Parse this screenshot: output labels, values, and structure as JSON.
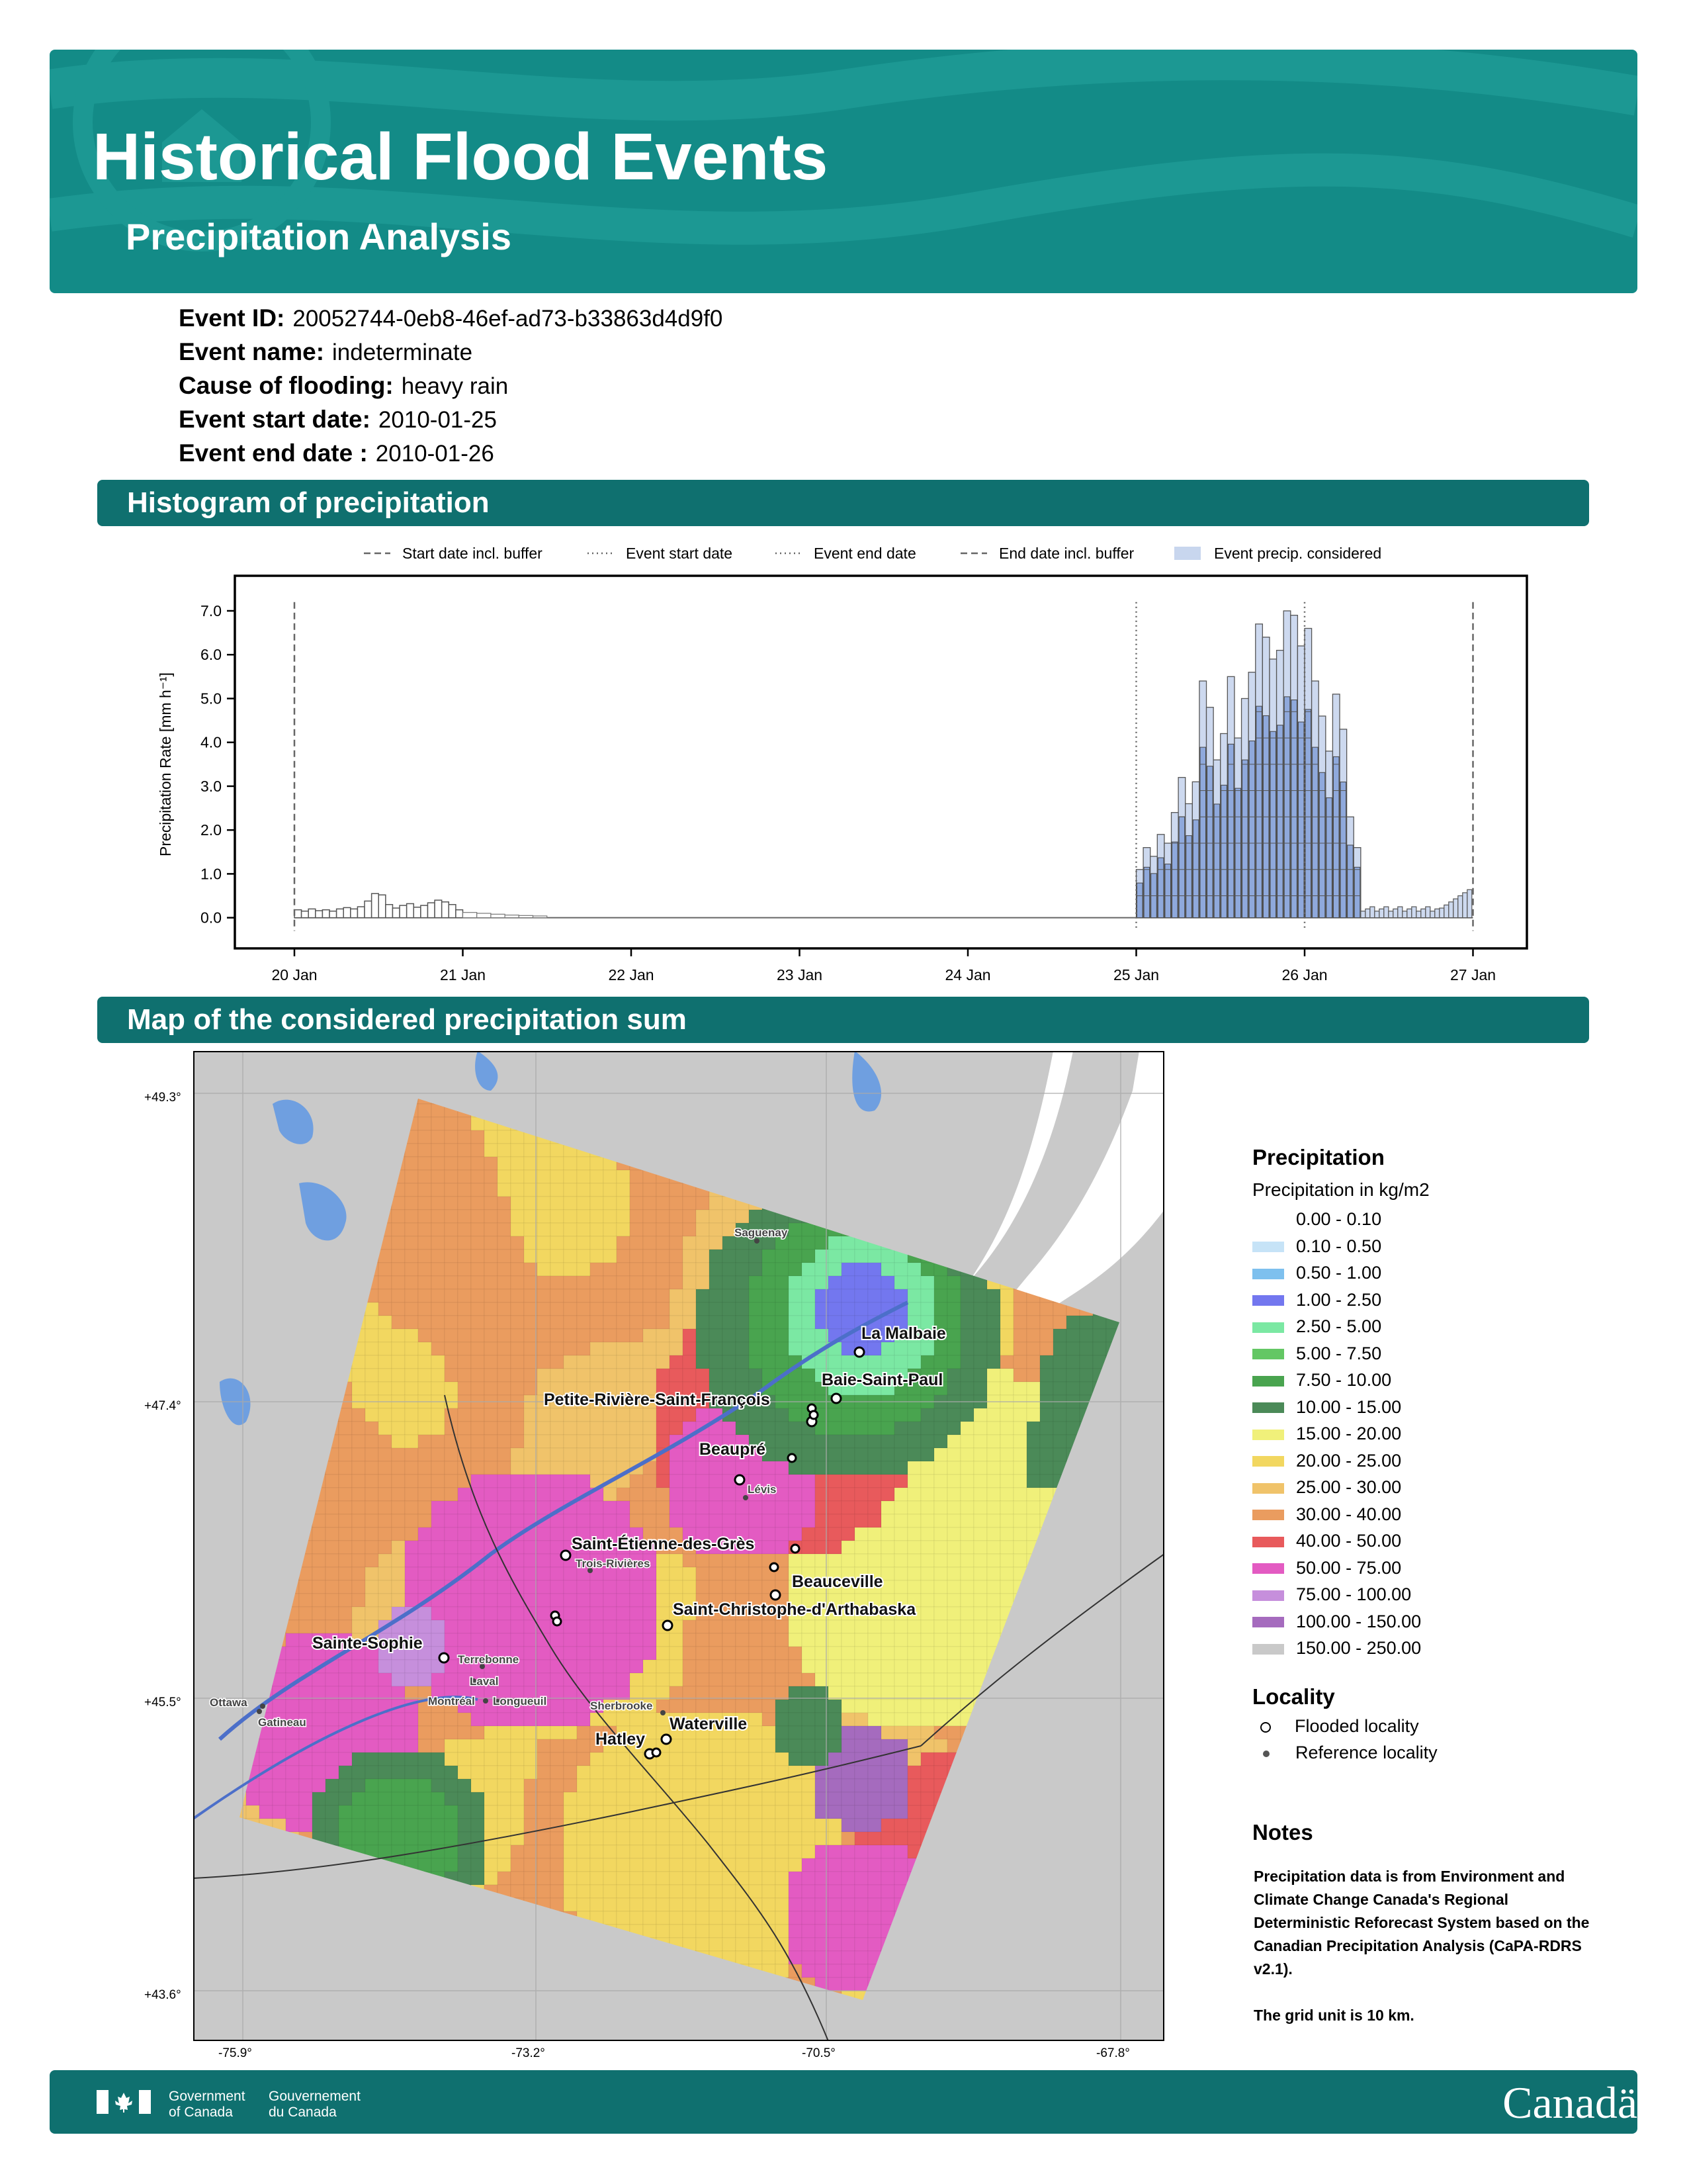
{
  "header": {
    "title": "Historical Flood Events",
    "subtitle": "Precipitation Analysis"
  },
  "event": {
    "id_label": "Event ID:",
    "id_value": "20052744-0eb8-46ef-ad73-b33863d4d9f0",
    "name_label": "Event name:",
    "name_value": "indeterminate",
    "cause_label": "Cause of flooding:",
    "cause_value": "heavy rain",
    "start_label": "Event start date:",
    "start_value": "2010-01-25",
    "end_label": "Event end date :",
    "end_value": "2010-01-26"
  },
  "sections": {
    "histogram": "Histogram of precipitation",
    "map": "Map of the considered precipitation sum"
  },
  "chart_data": {
    "type": "bar",
    "ylabel": "Precipitation Rate [mm h⁻¹]",
    "ylim": [
      -0.7,
      7.8
    ],
    "yticks": [
      "0.0",
      "1.0",
      "2.0",
      "3.0",
      "4.0",
      "5.0",
      "6.0",
      "7.0"
    ],
    "xticks": [
      "20 Jan",
      "21 Jan",
      "22 Jan",
      "23 Jan",
      "24 Jan",
      "25 Jan",
      "26 Jan",
      "27 Jan"
    ],
    "legend": [
      "Start date incl. buffer",
      "Event start date",
      "Event end date",
      "End date incl. buffer",
      "Event precip. considered"
    ],
    "event_envelope_hourly_from_25Jan": [
      1.1,
      1.6,
      1.4,
      1.9,
      1.7,
      2.4,
      3.2,
      2.6,
      3.1,
      5.4,
      4.8,
      3.6,
      4.2,
      5.5,
      4.1,
      5.0,
      5.6,
      6.7,
      6.4,
      5.9,
      6.1,
      7.0,
      6.9,
      6.2,
      6.6,
      5.4,
      4.6,
      3.8,
      5.1,
      4.3,
      2.3,
      1.6
    ],
    "pre_event_envelope_20Jan": [
      0.18,
      0.15,
      0.2,
      0.16,
      0.18,
      0.15,
      0.2,
      0.23,
      0.2,
      0.25,
      0.38,
      0.55,
      0.52,
      0.3,
      0.22,
      0.28,
      0.32,
      0.24,
      0.28,
      0.34,
      0.4,
      0.36,
      0.3,
      0.18
    ]
  },
  "map": {
    "lat_labels": [
      "+49.3°",
      "+47.4°",
      "+45.5°",
      "+43.6°"
    ],
    "lon_labels": [
      "-75.9°",
      "-73.2°",
      "-70.5°",
      "-67.8°"
    ],
    "flooded_localities": [
      "La Malbaie",
      "Baie-Saint-Paul",
      "Petite-Rivière-Saint-François",
      "Beaupré",
      "Saint-Étienne-des-Grès",
      "Beauceville",
      "Saint-Christophe-d'Arthabaska",
      "Sainte-Sophie",
      "Waterville",
      "Hatley"
    ],
    "reference_localities": [
      "Saguenay",
      "Lévis",
      "Trois-Rivières",
      "Terrebonne",
      "Laval",
      "Montréal",
      "Longueuil",
      "Sherbrooke",
      "Ottawa",
      "Gatineau"
    ]
  },
  "legend": {
    "precip_title": "Precipitation",
    "precip_sub": "Precipitation in kg/m2",
    "classes": [
      {
        "label": "0.00 - 0.10",
        "color": "#ffffff"
      },
      {
        "label": "0.10 - 0.50",
        "color": "#c6e3f7"
      },
      {
        "label": "0.50 - 1.00",
        "color": "#7ec0ee"
      },
      {
        "label": "1.00 - 2.50",
        "color": "#7377ef"
      },
      {
        "label": "2.50 - 5.00",
        "color": "#7be8a3"
      },
      {
        "label": "5.00 - 7.50",
        "color": "#63c764"
      },
      {
        "label": "7.50 - 10.00",
        "color": "#49a44f"
      },
      {
        "label": "10.00 - 15.00",
        "color": "#4b8a58"
      },
      {
        "label": "15.00 - 20.00",
        "color": "#f0f07a"
      },
      {
        "label": "20.00 - 25.00",
        "color": "#f2d760"
      },
      {
        "label": "25.00 - 30.00",
        "color": "#f0c36a"
      },
      {
        "label": "30.00 - 40.00",
        "color": "#ea9c5f"
      },
      {
        "label": "40.00 - 50.00",
        "color": "#e85a5c"
      },
      {
        "label": "50.00 - 75.00",
        "color": "#e35bc2"
      },
      {
        "label": "75.00 - 100.00",
        "color": "#c68fdc"
      },
      {
        "label": "100.00 - 150.00",
        "color": "#a56bbe"
      },
      {
        "label": "150.00 - 250.00",
        "color": "#c9c9c9"
      }
    ],
    "locality_title": "Locality",
    "flooded_label": "Flooded locality",
    "reference_label": "Reference locality",
    "notes_title": "Notes",
    "notes_1": "Precipitation data is from Environment and Climate Change Canada's Regional Deterministic Reforecast System based on the Canadian Precipitation Analysis (CaPA-RDRS v2.1).",
    "notes_2": "The grid unit is 10 km."
  },
  "footer": {
    "gov_en": "Government\nof Canada",
    "gov_fr": "Gouvernement\ndu Canada",
    "wordmark": "Canadä"
  }
}
